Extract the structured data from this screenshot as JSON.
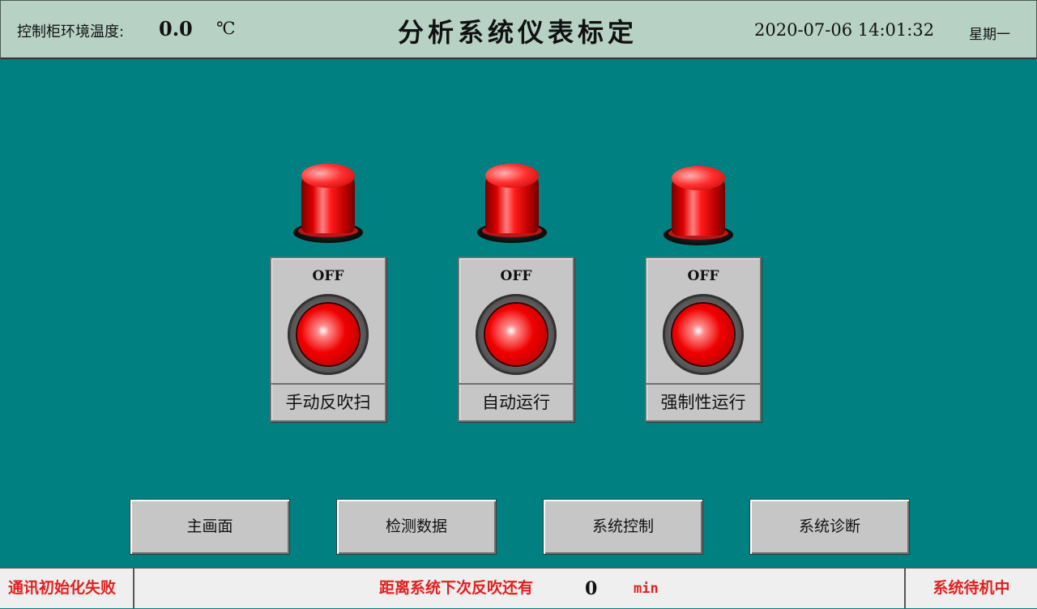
{
  "header": {
    "temp_label": "控制柜环境温度:",
    "temp_value": "0.0",
    "temp_unit": "℃",
    "title": "分析系统仪表标定",
    "datetime": "2020-07-06 14:01:32",
    "weekday": "星期一"
  },
  "controls": [
    {
      "state": "OFF",
      "label": "手动反吹扫",
      "lamp_color": "#e00000"
    },
    {
      "state": "OFF",
      "label": "自动运行",
      "lamp_color": "#e00000"
    },
    {
      "state": "OFF",
      "label": "强制性运行",
      "lamp_color": "#e00000"
    }
  ],
  "nav": {
    "main": "主画面",
    "data": "检测数据",
    "control": "系统控制",
    "diagnosis": "系统诊断"
  },
  "status": {
    "comm": "通讯初始化失败",
    "countdown_label": "距离系统下次反吹还有",
    "countdown_value": "0",
    "countdown_unit": "min",
    "system_state": "系统待机中"
  },
  "colors": {
    "background": "#008080",
    "header_bg": "#b7d2c5",
    "alert_text": "#e02020"
  }
}
